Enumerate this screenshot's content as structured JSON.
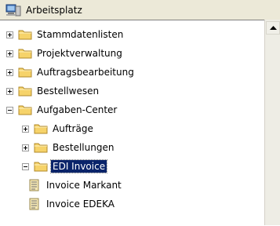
{
  "window": {
    "title": "Arbeitsplatz",
    "title_icon": "computer-icon"
  },
  "tree": {
    "items": [
      {
        "label": "Stammdatenlisten",
        "level": 0,
        "expander": "plus",
        "icon": "folder-icon",
        "selected": false
      },
      {
        "label": "Projektverwaltung",
        "level": 0,
        "expander": "plus",
        "icon": "folder-icon",
        "selected": false
      },
      {
        "label": "Auftragsbearbeitung",
        "level": 0,
        "expander": "plus",
        "icon": "folder-icon",
        "selected": false
      },
      {
        "label": "Bestellwesen",
        "level": 0,
        "expander": "plus",
        "icon": "folder-icon",
        "selected": false
      },
      {
        "label": "Aufgaben-Center",
        "level": 0,
        "expander": "minus",
        "icon": "folder-icon",
        "selected": false
      },
      {
        "label": "Aufträge",
        "level": 1,
        "expander": "plus",
        "icon": "folder-icon",
        "selected": false
      },
      {
        "label": "Bestellungen",
        "level": 1,
        "expander": "plus",
        "icon": "folder-icon",
        "selected": false
      },
      {
        "label": "EDI Invoice",
        "level": 1,
        "expander": "minus",
        "icon": "folder-icon",
        "selected": true
      },
      {
        "label": "Invoice Markant",
        "level": 2,
        "expander": "none",
        "icon": "document-icon",
        "selected": false
      },
      {
        "label": "Invoice EDEKA",
        "level": 2,
        "expander": "none",
        "icon": "document-icon",
        "selected": false
      }
    ]
  },
  "colors": {
    "selection": "#0a246a",
    "folder": "#f6d36a",
    "titlebar": "#ece9d8"
  }
}
